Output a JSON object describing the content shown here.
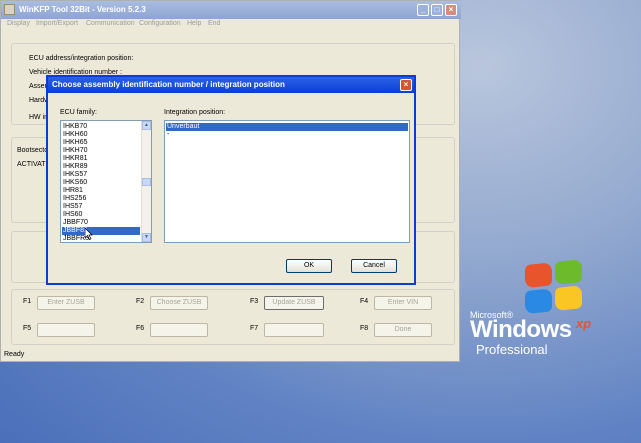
{
  "window": {
    "title": "WinKFP Tool 32Bit - Version 5.2.3",
    "controls": {
      "minimize": "_",
      "maximize": "□",
      "close": "×"
    }
  },
  "menu": [
    "Display",
    "Import/Export",
    "Communication",
    "Configuration",
    "Help",
    "End"
  ],
  "info_labels": {
    "ecu_address": "ECU address/integration position:",
    "vin": "Vehicle identification number :",
    "asse": "Assem",
    "hard": "Hardw",
    "hw": "HW in"
  },
  "boot_labels": {
    "bootsector": "Bootsector",
    "activate": "ACTIVATE"
  },
  "function_keys": [
    {
      "key": "F1",
      "label": "Enter ZUSB"
    },
    {
      "key": "F2",
      "label": "Choose ZUSB"
    },
    {
      "key": "F3",
      "label": "Update ZUSB"
    },
    {
      "key": "F4",
      "label": "Enter VIN"
    },
    {
      "key": "F5",
      "label": ""
    },
    {
      "key": "F6",
      "label": ""
    },
    {
      "key": "F7",
      "label": ""
    },
    {
      "key": "F8",
      "label": "Done"
    }
  ],
  "status": "Ready",
  "dialog": {
    "title": "Choose assembly identification number / integration position",
    "close": "×",
    "ecu_family_label": "ECU family:",
    "integration_label": "Integration position:",
    "ecu_families": [
      "IHKB70",
      "IHKH60",
      "IHKH65",
      "IHKH70",
      "IHKR81",
      "IHKR89",
      "IHKS57",
      "IHKS60",
      "IHR81",
      "IHS256",
      "IHS57",
      "IHS60",
      "JBBF70",
      "JBBF81",
      "JBBFR3"
    ],
    "ecu_selected": "JBBF81",
    "integration_positions": [
      "Unverbaut",
      "-"
    ],
    "integration_selected": "Unverbaut",
    "ok_label": "OK",
    "cancel_label": "Cancel"
  },
  "desktop_logo": {
    "microsoft": "Microsoft®",
    "windows": "Windows",
    "xp": "xp",
    "edition": "Professional"
  }
}
